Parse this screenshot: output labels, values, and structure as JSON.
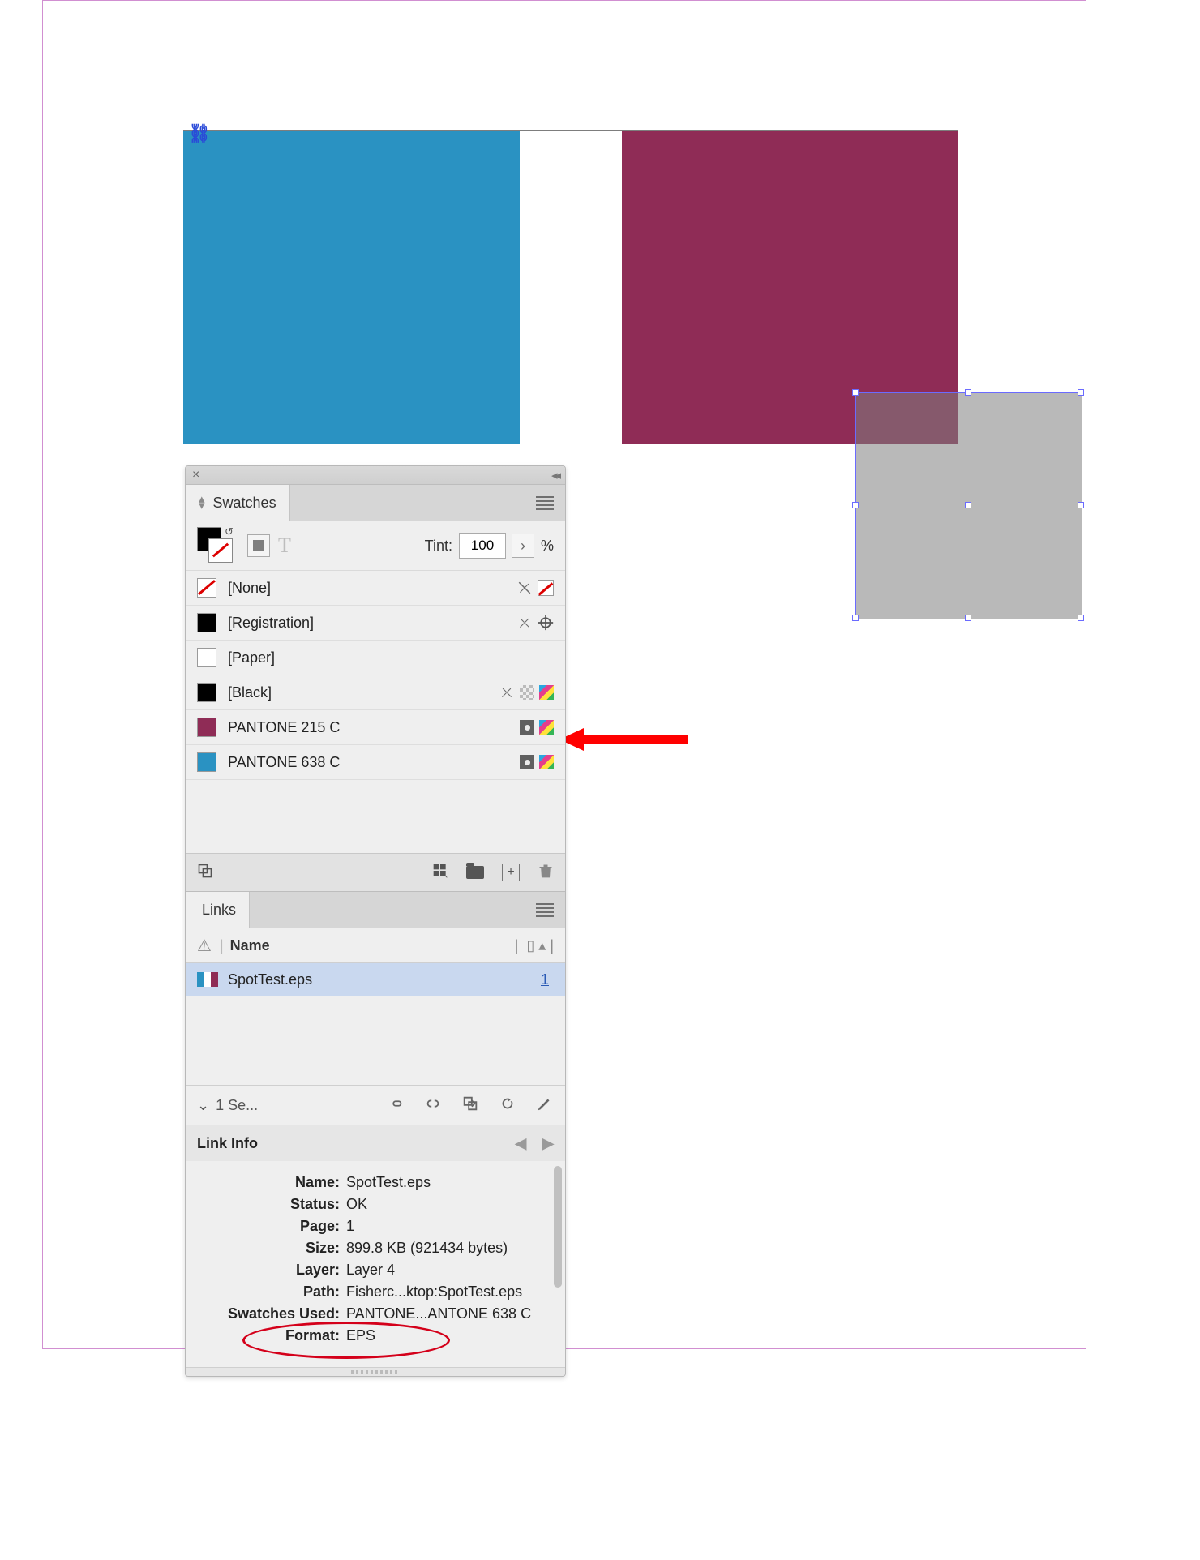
{
  "panels": {
    "swatches": {
      "tab_label": "Swatches",
      "tint_label": "Tint:",
      "tint_value": "100",
      "tint_unit": "%",
      "rows": [
        {
          "name": "[None]",
          "chip": "none",
          "icons": [
            "lock",
            "nonebox"
          ]
        },
        {
          "name": "[Registration]",
          "chip": "#000",
          "icons": [
            "lock",
            "reg"
          ]
        },
        {
          "name": "[Paper]",
          "chip": "#fff",
          "icons": []
        },
        {
          "name": "[Black]",
          "chip": "#000",
          "icons": [
            "lock",
            "checker",
            "proc"
          ]
        },
        {
          "name": "PANTONE 215 C",
          "chip": "#8f2c56",
          "icons": [
            "spot",
            "proc"
          ]
        },
        {
          "name": "PANTONE 638 C",
          "chip": "#2a92c2",
          "icons": [
            "spot",
            "proc"
          ]
        }
      ]
    },
    "links": {
      "tab_label": "Links",
      "header_name": "Name",
      "row": {
        "name": "SpotTest.eps",
        "page": "1"
      },
      "selected_label": "1 Se..."
    },
    "linkinfo": {
      "title": "Link Info",
      "rows": [
        {
          "label": "Name:",
          "value": "SpotTest.eps"
        },
        {
          "label": "Status:",
          "value": "OK"
        },
        {
          "label": "Page:",
          "value": "1"
        },
        {
          "label": "Size:",
          "value": "899.8 KB (921434 bytes)"
        },
        {
          "label": "Layer:",
          "value": "Layer 4"
        },
        {
          "label": "Path:",
          "value": "Fisherc...ktop:SpotTest.eps"
        },
        {
          "label": "Swatches Used:",
          "value": "PANTONE...ANTONE 638 C"
        },
        {
          "label": "Format:",
          "value": "EPS"
        }
      ]
    }
  },
  "artboard": {
    "colors": {
      "left": "#2a92c2",
      "right": "#8f2c56"
    }
  }
}
